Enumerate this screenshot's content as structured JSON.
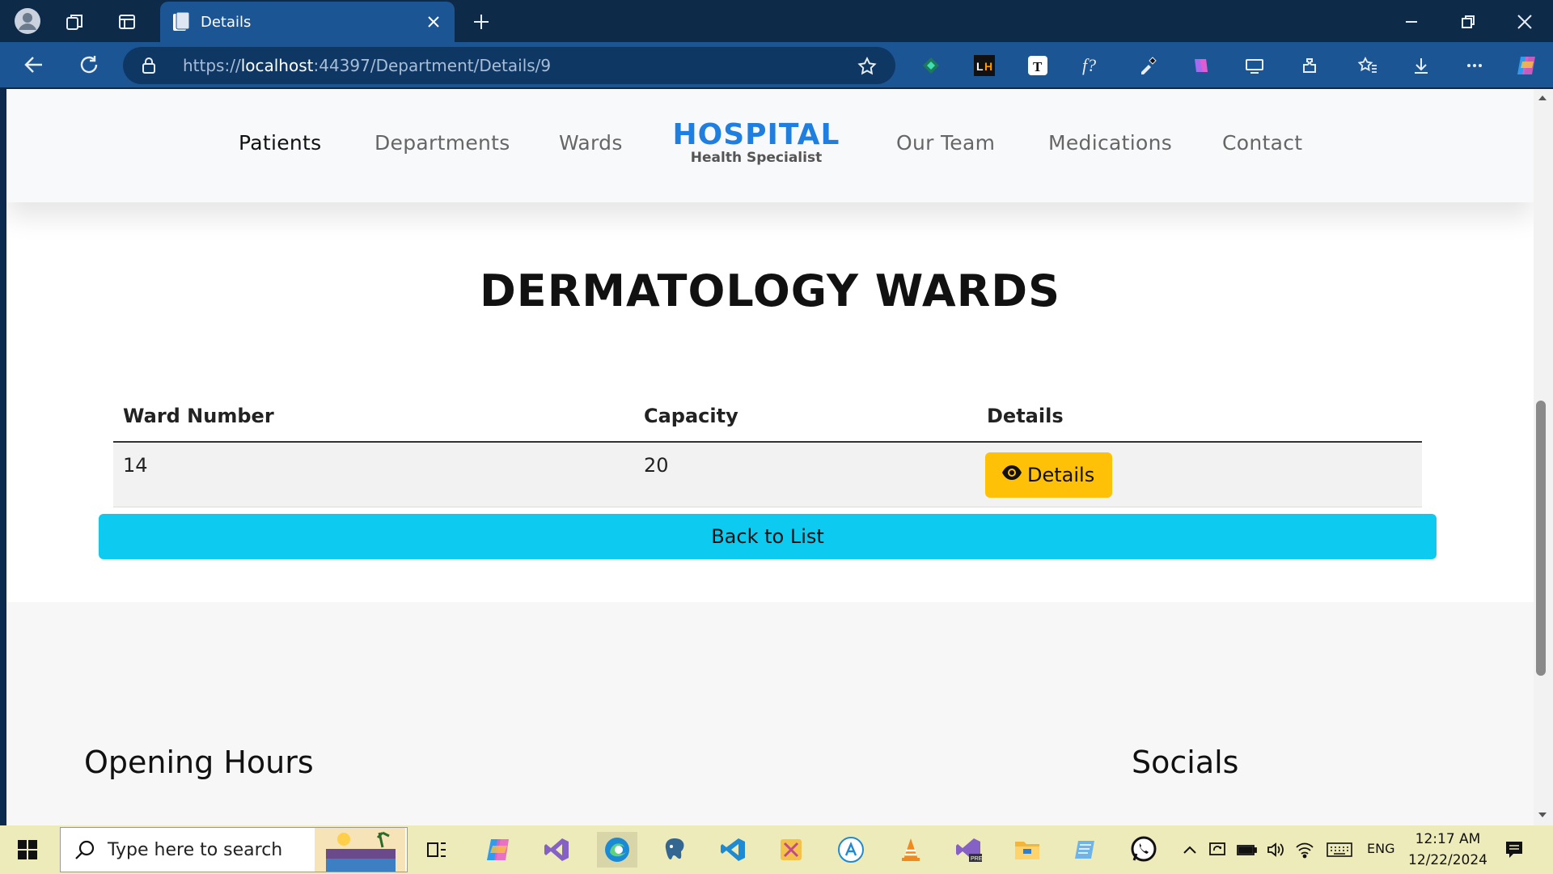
{
  "browser": {
    "tab_title": "Details",
    "url_scheme": "https://",
    "url_host": "localhost",
    "url_path": ":44397/Department/Details/9"
  },
  "nav": {
    "patients": "Patients",
    "departments": "Departments",
    "wards": "Wards",
    "brand_title": "HOSPITAL",
    "brand_subtitle": "Health Specialist",
    "our_team": "Our Team",
    "medications": "Medications",
    "contact": "Contact"
  },
  "page": {
    "title": "DERMATOLOGY WARDS",
    "table": {
      "headers": [
        "Ward Number",
        "Capacity",
        "Details"
      ],
      "rows": [
        {
          "ward_number": "14",
          "capacity": "20",
          "details_label": "Details"
        }
      ]
    },
    "back_label": "Back to List"
  },
  "footer": {
    "opening_hours": "Opening Hours",
    "socials": "Socials"
  },
  "taskbar": {
    "search_placeholder": "Type here to search",
    "language": "ENG",
    "time": "12:17 AM",
    "date": "12/22/2024"
  },
  "colors": {
    "brand": "#1f7fe0",
    "details_button": "#ffc107",
    "back_button": "#0dcaf0",
    "browser_toolbar": "#1b5594"
  }
}
